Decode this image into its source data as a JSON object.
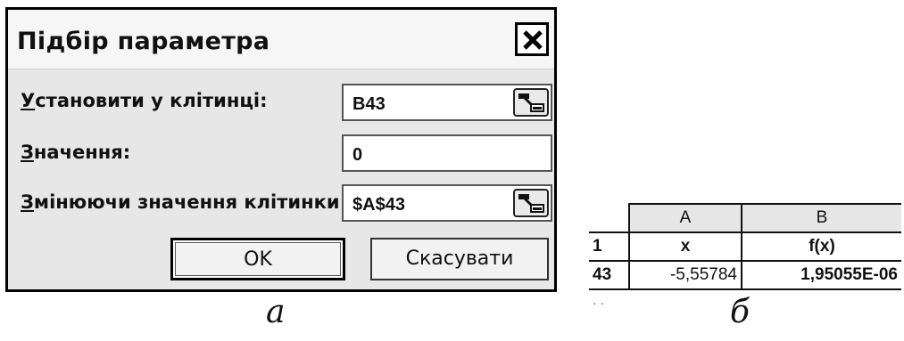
{
  "dialog": {
    "title": "Підбір параметра",
    "close_label": "✕",
    "fields": [
      {
        "label_prefix": "У",
        "label_rest": "становити у клітинці:",
        "value": "B43"
      },
      {
        "label_prefix": "З",
        "label_rest": "начення:",
        "value": "0"
      },
      {
        "label_prefix": "З",
        "label_rest": "мінюючи значення клітинки:",
        "value": "$A$43"
      }
    ],
    "ok_label": "OK",
    "cancel_label": "Скасувати"
  },
  "captions": {
    "left": "а",
    "right": "б"
  },
  "sheet": {
    "columns": [
      "A",
      "B"
    ],
    "rows": [
      {
        "row": "1",
        "a": "x",
        "b": "f(x)"
      },
      {
        "row": "43",
        "a": "-5,55784",
        "b": "1,95055E-06"
      }
    ]
  }
}
